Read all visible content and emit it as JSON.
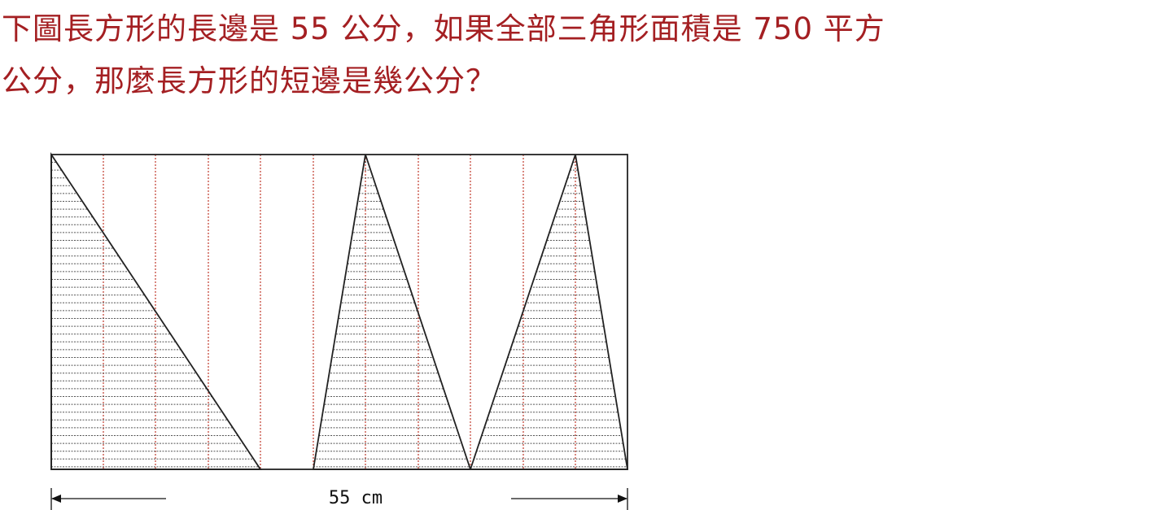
{
  "question": {
    "line1": "下圖長方形的長邊是 55 公分，如果全部三角形面積是 750 平方",
    "line2": "公分，那麼長方形的短邊是幾公分？"
  },
  "figure": {
    "dimension_label": "55 cm",
    "colors": {
      "question_text": "#a41f22",
      "outline": "#222222",
      "grid_lines": "#c0392b",
      "hatch": "#555555"
    }
  }
}
